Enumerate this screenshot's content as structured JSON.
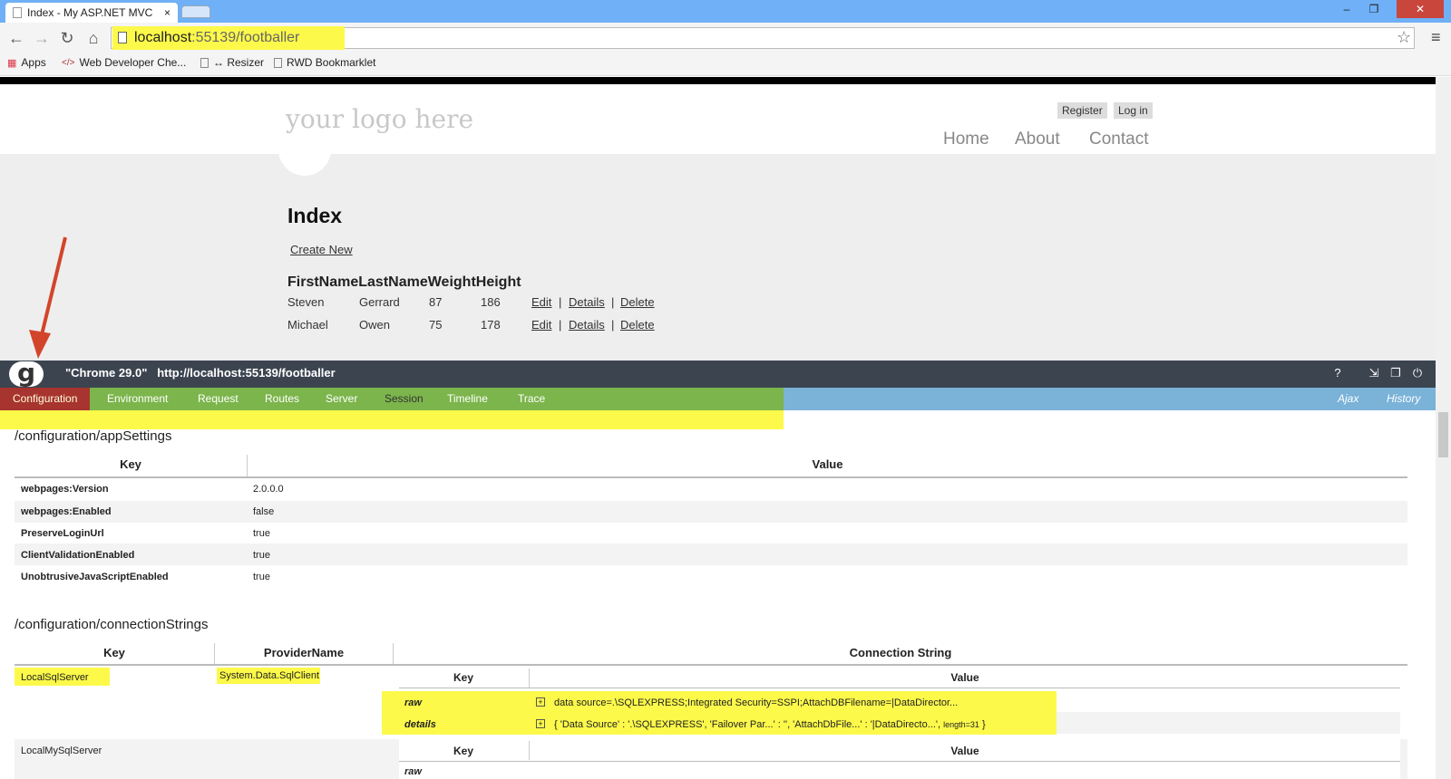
{
  "browser": {
    "tab_title": "Index - My ASP.NET MVC",
    "tab_close": "×",
    "url_host": "localhost",
    "url_rest": ":55139/footballer",
    "bookmarks": [
      "Apps",
      "Web Developer Che...",
      "↔ Resizer",
      "RWD Bookmarklet"
    ],
    "window_controls": [
      "–",
      "❐",
      "✕"
    ]
  },
  "site": {
    "logo": "your logo here",
    "auth": {
      "register": "Register",
      "login": "Log in"
    },
    "nav": {
      "home": "Home",
      "about": "About",
      "contact": "Contact"
    },
    "heading": "Index",
    "create_new": "Create New",
    "columns": [
      "FirstName",
      "LastName",
      "Weight",
      "Height"
    ],
    "rows": [
      {
        "first": "Steven",
        "last": "Gerrard",
        "weight": "87",
        "height": "186"
      },
      {
        "first": "Michael",
        "last": "Owen",
        "weight": "75",
        "height": "178"
      }
    ],
    "actions": {
      "edit": "Edit",
      "details": "Details",
      "delete": "Delete",
      "sep": "|"
    }
  },
  "glimpse": {
    "title": "\"Chrome 29.0\"   http://localhost:55139/footballer",
    "logo_letter": "g",
    "icons": [
      "?",
      "⇲",
      "❐",
      "⏻"
    ],
    "tabs": [
      "Configuration",
      "Environment",
      "Request",
      "Routes",
      "Server",
      "Session",
      "Timeline",
      "Trace"
    ],
    "right_tabs": [
      "Ajax",
      "History"
    ],
    "app_settings": {
      "title": "/configuration/appSettings",
      "key_header": "Key",
      "value_header": "Value",
      "rows": [
        {
          "key": "webpages:Version",
          "value": "2.0.0.0"
        },
        {
          "key": "webpages:Enabled",
          "value": "false"
        },
        {
          "key": "PreserveLoginUrl",
          "value": "true"
        },
        {
          "key": "ClientValidationEnabled",
          "value": "true"
        },
        {
          "key": "UnobtrusiveJavaScriptEnabled",
          "value": "true"
        }
      ]
    },
    "conn_strings": {
      "title": "/configuration/connectionStrings",
      "headers": {
        "key": "Key",
        "provider": "ProviderName",
        "conn": "Connection String"
      },
      "sub_headers": {
        "key": "Key",
        "value": "Value"
      },
      "rows": [
        {
          "key": "LocalSqlServer",
          "provider": "System.Data.SqlClient",
          "raw_label": "raw",
          "raw_value": "data source=.\\SQLEXPRESS;Integrated Security=SSPI;AttachDBFilename=|DataDirector...",
          "details_label": "details",
          "details_value": "{ 'Data Source' : '.\\SQLEXPRESS', 'Failover Par...' : '', 'AttachDbFile...' : '|DataDirecto...',",
          "details_length": "length=31",
          "details_close": "}"
        },
        {
          "key": "LocalMySqlServer",
          "raw_label": "raw"
        }
      ]
    }
  }
}
